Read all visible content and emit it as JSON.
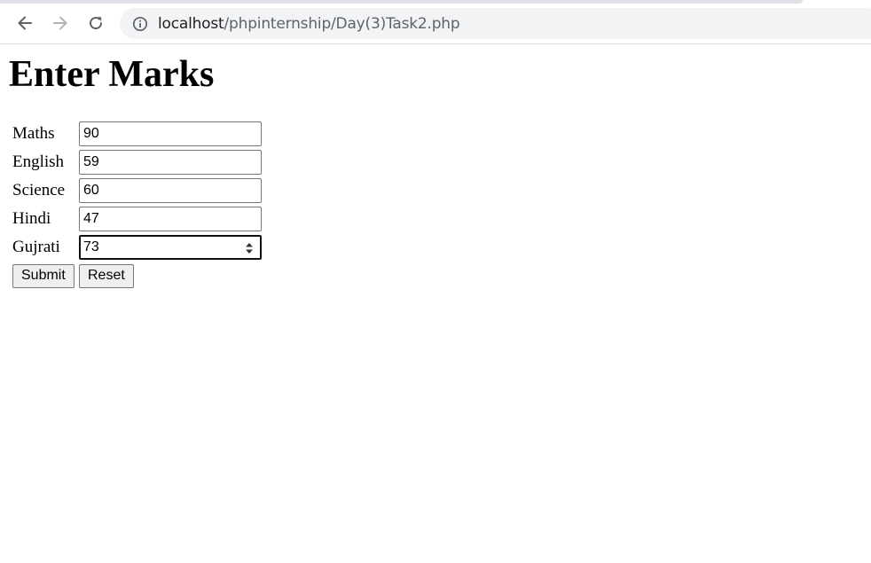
{
  "browser": {
    "url_host": "localhost",
    "url_path": "/phpinternship/Day(3)Task2.php",
    "icons": {
      "back": "arrow-left-icon",
      "forward": "arrow-right-icon",
      "reload": "reload-icon",
      "info": "info-icon"
    }
  },
  "page": {
    "title": "Enter Marks",
    "fields": [
      {
        "label": "Maths",
        "value": "90"
      },
      {
        "label": "English",
        "value": "59"
      },
      {
        "label": "Science",
        "value": "60"
      },
      {
        "label": "Hindi",
        "value": "47"
      },
      {
        "label": "Gujrati",
        "value": "73"
      }
    ],
    "buttons": {
      "submit": "Submit",
      "reset": "Reset"
    }
  }
}
